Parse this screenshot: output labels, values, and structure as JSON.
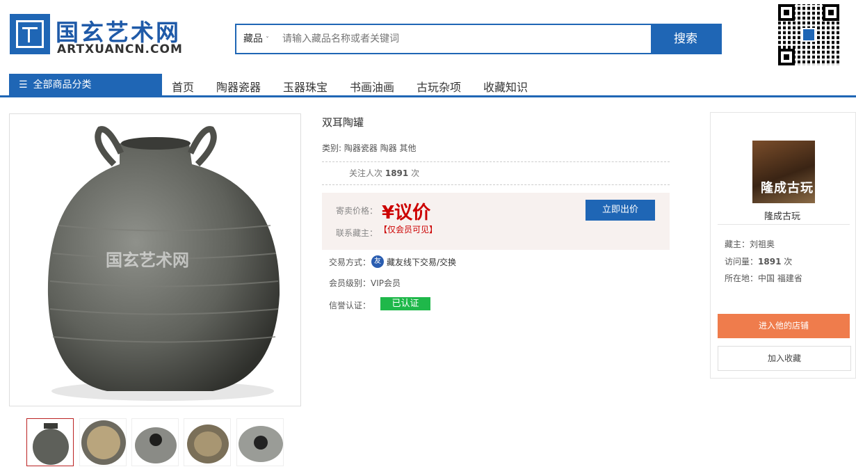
{
  "header": {
    "logo_cn": "国玄艺术网",
    "logo_en": "ARTXUANCN.COM",
    "search": {
      "category": "藏品",
      "placeholder": "请输入藏品名称或者关键词",
      "button": "搜索"
    }
  },
  "nav": {
    "all_categories": "全部商品分类",
    "items": [
      "首页",
      "陶器瓷器",
      "玉器珠宝",
      "书画油画",
      "古玩杂项",
      "收藏知识"
    ]
  },
  "product": {
    "watermark": "国玄艺术网",
    "title": "双耳陶罐",
    "category_label": "类别:",
    "category_value": "陶器瓷器 陶器 其他",
    "follow_label": "关注人次",
    "follow_count": "1891",
    "follow_unit": "次",
    "price_label": "寄卖价格：",
    "price_value": "¥议价",
    "contact_label": "联系藏主：",
    "contact_value": "【仅会员可见】",
    "offer_button": "立即出价",
    "trade_label": "交易方式：",
    "trade_icon_text": "友",
    "trade_value": "藏友线下交易/交换",
    "member_label": "会员级别：",
    "member_value": "VIP会员",
    "credit_label": "信誉认证：",
    "credit_value": "已认证"
  },
  "shop": {
    "image_text": "隆成古玩",
    "name": "隆成古玩",
    "owner_label": "藏主：",
    "owner_value": "刘祖奥",
    "visits_label": "访问量：",
    "visits_value": "1891",
    "visits_unit": "次",
    "location_label": "所在地：",
    "location_value": "中国 福建省",
    "enter_button": "进入他的店铺",
    "favorite_button": "加入收藏"
  },
  "colors": {
    "brand_blue": "#1f66b5",
    "price_red": "#cc0000",
    "verified_green": "#1fb84a",
    "enter_orange": "#ef7c4c"
  }
}
